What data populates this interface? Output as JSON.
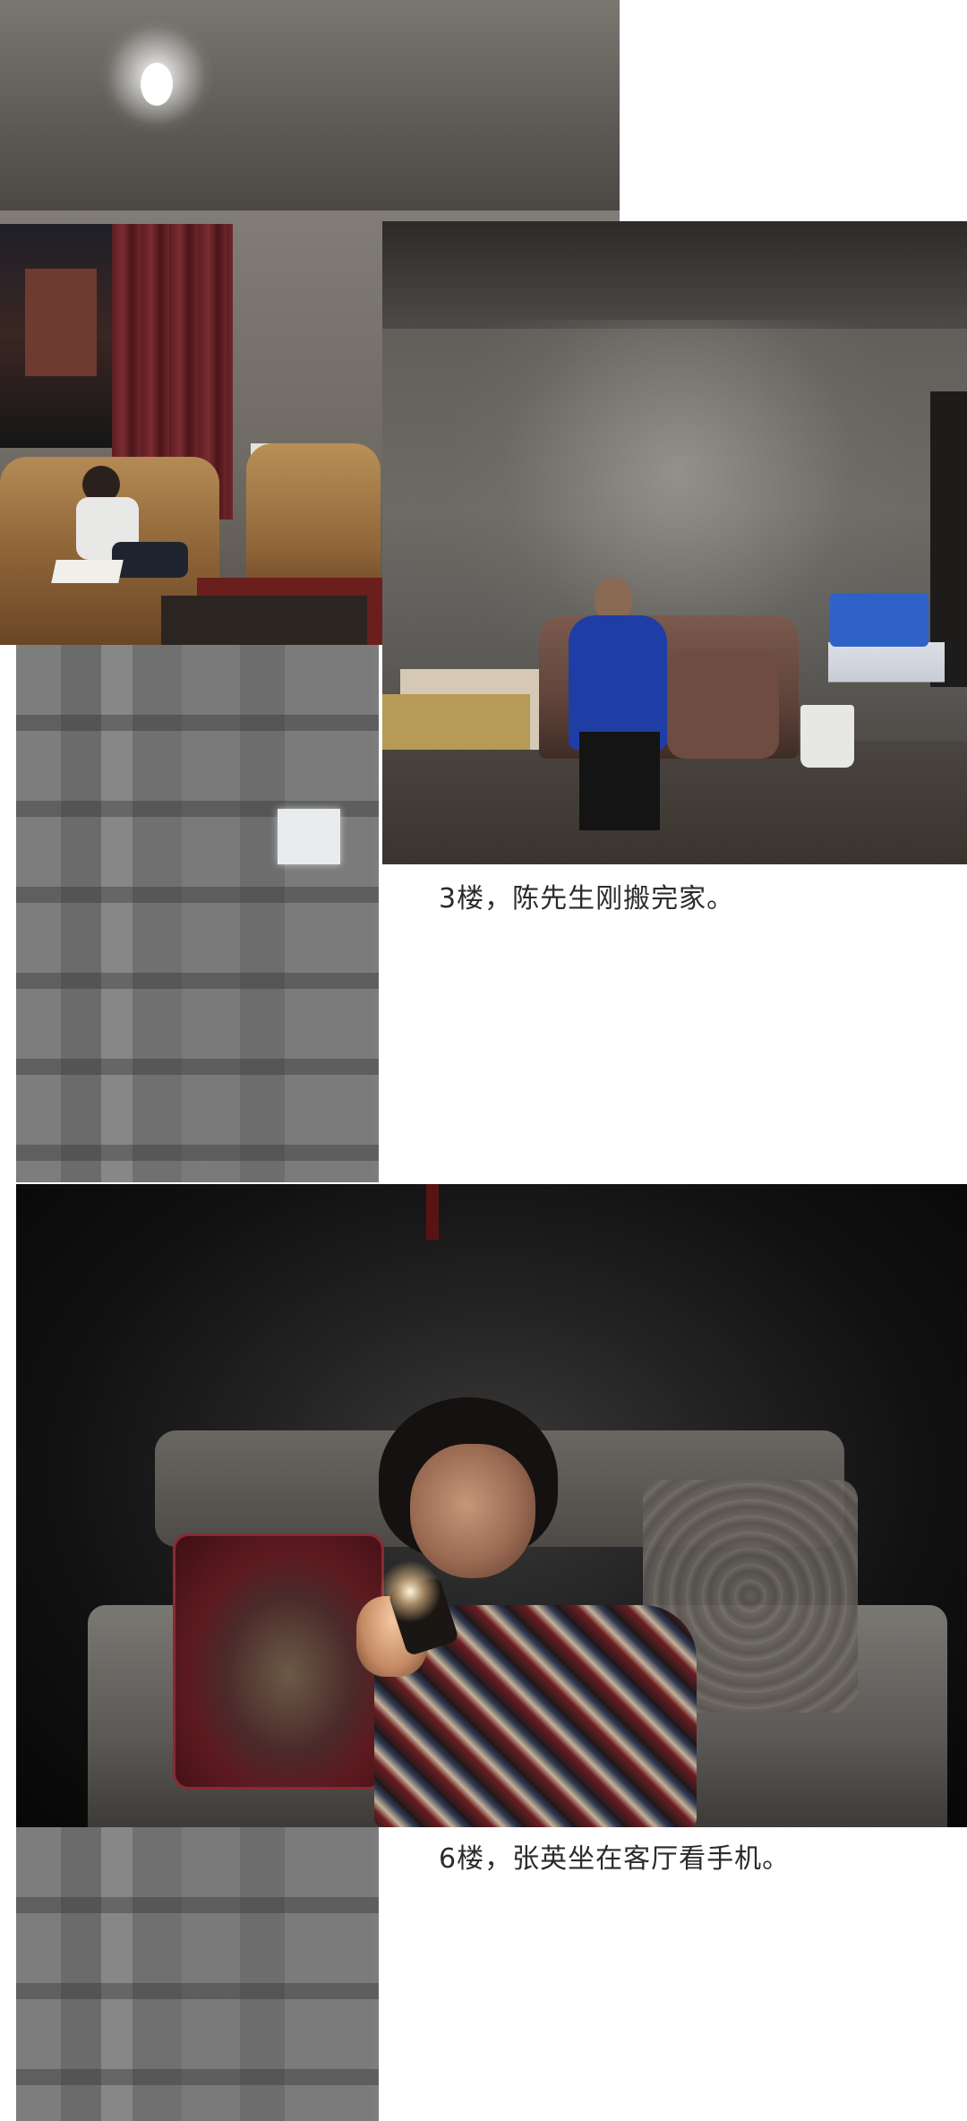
{
  "captions": {
    "photo_2": "3楼，陈先生刚搬完家。",
    "photo_3": "6楼，张英坐在客厅看手机。"
  }
}
